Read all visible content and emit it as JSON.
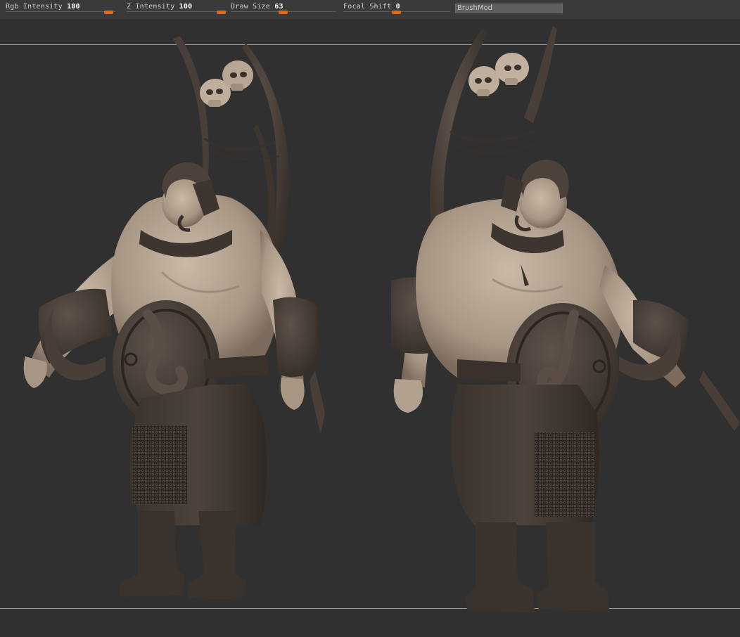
{
  "toolbar": {
    "rgb_intensity": {
      "label": "Rgb Intensity",
      "value": "100",
      "level": 1.0
    },
    "z_intensity": {
      "label": "Z Intensity",
      "value": "100",
      "level": 1.0
    },
    "draw_size": {
      "label": "Draw Size",
      "value": "63",
      "level": 0.45
    },
    "focal_shift": {
      "label": "Focal Shift",
      "value": "0",
      "level": 0.5
    },
    "brush_field": {
      "text": "BrushMod"
    }
  },
  "colors": {
    "accent": "#e8680c",
    "canvas": "#303030",
    "toolbar": "#3a3a3a",
    "skin": "#b8a896",
    "leather": "#4a3f38"
  },
  "viewport": {
    "models": [
      {
        "name": "ogre-front-view"
      },
      {
        "name": "ogre-side-view"
      }
    ]
  }
}
